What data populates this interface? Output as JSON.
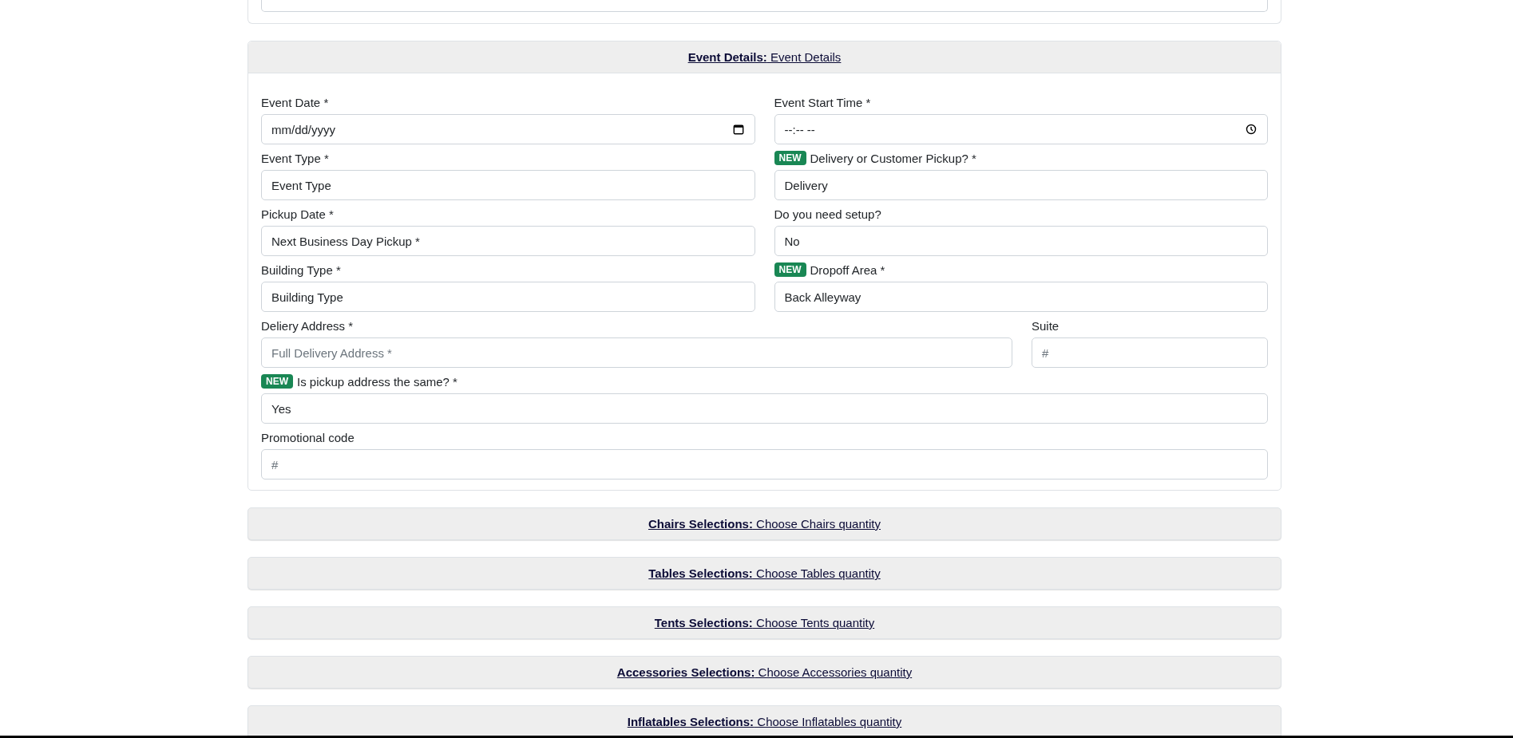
{
  "sections": [
    {
      "title": "Event Details:",
      "subtitle": "Event Details",
      "expanded": true,
      "rows": [
        {
          "kind": "half",
          "fields": [
            {
              "label": "Event Date *",
              "kind": "date",
              "placeholder": "mm/dd/yyyy"
            },
            {
              "label": "Event Start Time *",
              "kind": "time",
              "placeholder": "--:-- --"
            }
          ]
        },
        {
          "kind": "half",
          "fields": [
            {
              "label": "Event Type *",
              "kind": "text",
              "value": "Event Type"
            },
            {
              "label": "Delivery or Customer Pickup? *",
              "badge": "NEW",
              "kind": "text",
              "value": "Delivery"
            }
          ]
        },
        {
          "kind": "half",
          "fields": [
            {
              "label": "Pickup Date *",
              "kind": "text",
              "value": "Next Business Day Pickup *"
            },
            {
              "label": "Do you need setup?",
              "kind": "text",
              "value": "No"
            }
          ]
        },
        {
          "kind": "half",
          "fields": [
            {
              "label": "Building Type *",
              "kind": "text",
              "value": "Building Type"
            },
            {
              "label": "Dropoff Area *",
              "badge": "NEW",
              "kind": "text",
              "value": "Back Alleyway"
            }
          ]
        },
        {
          "kind": "address",
          "fields": [
            {
              "label": "Deliery Address *",
              "kind": "text",
              "placeholder": "Full Delivery Address *"
            },
            {
              "label": "Suite",
              "kind": "text",
              "placeholder": "#"
            }
          ]
        },
        {
          "kind": "full",
          "fields": [
            {
              "label": "Is pickup address the same? *",
              "badge": "NEW",
              "kind": "text",
              "value": "Yes"
            }
          ]
        },
        {
          "kind": "full",
          "fields": [
            {
              "label": "Promotional code",
              "kind": "text",
              "placeholder": "#"
            }
          ]
        }
      ]
    },
    {
      "title": "Chairs Selections:",
      "subtitle": "Choose Chairs quantity",
      "expanded": false
    },
    {
      "title": "Tables Selections:",
      "subtitle": "Choose Tables quantity",
      "expanded": false
    },
    {
      "title": "Tents Selections:",
      "subtitle": "Choose Tents quantity",
      "expanded": false
    },
    {
      "title": "Accessories Selections:",
      "subtitle": "Choose Accessories quantity",
      "expanded": false
    },
    {
      "title": "Inflatables Selections:",
      "subtitle": "Choose Inflatables quantity",
      "expanded": false
    }
  ]
}
